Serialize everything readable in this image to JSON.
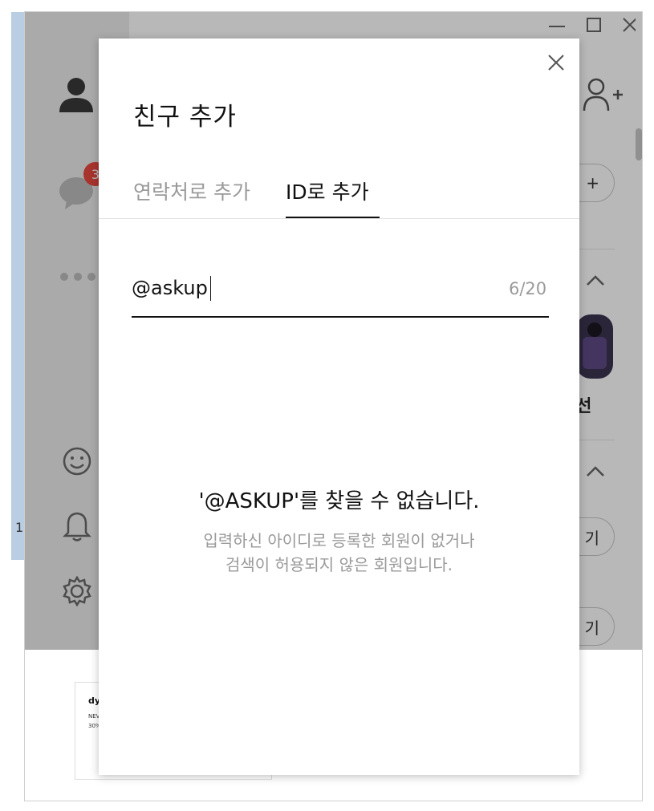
{
  "desktop": {
    "left_digit": "1"
  },
  "app": {
    "chat_badge": "3",
    "main_pill_1": "+",
    "main_pill_2": "기",
    "main_pill_3": "기",
    "profile_name_fragment": "선",
    "ad": {
      "brand": "dy",
      "line1": "NEV",
      "line2": "30%"
    }
  },
  "modal": {
    "title": "친구 추가",
    "tabs": [
      {
        "label": "연락처로 추가",
        "active": false
      },
      {
        "label": "ID로 추가",
        "active": true
      }
    ],
    "id_input": {
      "value": "@askup",
      "char_count": "6/20"
    },
    "result": {
      "title": "'@ASKUP'를 찾을 수 없습니다.",
      "line1": "입력하신 아이디로 등록한 회원이 없거나",
      "line2": "검색이 허용되지 않은 회원입니다."
    }
  },
  "colors": {
    "active_tab": "#111111",
    "inactive_tab": "#9a9a9a",
    "badge": "#e8483f",
    "overlay": "rgba(0,0,0,0.28)"
  }
}
